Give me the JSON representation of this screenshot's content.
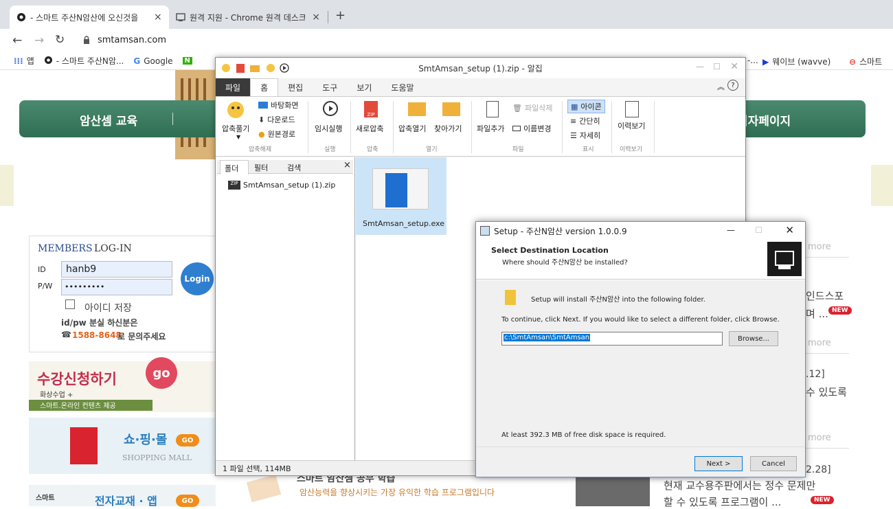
{
  "browser": {
    "tabs": [
      {
        "title": "- 스마트 주산N암산에 오신것을",
        "active": true
      },
      {
        "title": "원격 지원 - Chrome 원격 데스크",
        "active": false
      }
    ],
    "new_tab": "+",
    "url": "smtamsan.com",
    "bookmarks": [
      {
        "label": "앱",
        "icon": "apps-icon"
      },
      {
        "label": "- 스마트 주산N암...",
        "icon": "site-icon"
      },
      {
        "label": "Google",
        "icon": "google-icon"
      },
      {
        "label": "웨이브 (wavve)",
        "icon": "wavve-icon"
      },
      {
        "label": "스마트",
        "icon": "site-icon"
      }
    ],
    "bookmark_ellipsis": "-..."
  },
  "webpage": {
    "nav": {
      "left": "암산셈 교육",
      "right": "리자페이지"
    },
    "login": {
      "header_members": "MEMBERS",
      "header_login": "LOG-IN",
      "id_label": "ID",
      "pw_label": "P/W",
      "id_value": "hanb9",
      "pw_value": "•••••••••",
      "login_button": "Login",
      "remember": "아이디 저장",
      "lost_1": "id/pw 분실 하신분은",
      "phone": "1588-8648",
      "lost_2": "로 문의주세요"
    },
    "banners": {
      "apply": "수강신청하기",
      "apply_sub1": "화상수업 +",
      "apply_sub2": "스마트.온라인 컨텐츠 제공",
      "go": "go",
      "shop": "쇼·핑·몰",
      "shop_en": "SHOPPING MALL",
      "shop_go": "GO",
      "smart": "스마트",
      "ebook": "전자교재 · 앱",
      "ebook_go": "GO"
    },
    "center": {
      "heading": "스마트 암산셈 공부 학습",
      "sub": "암산능력을 향상시키는 가장 유익한 학습 프로그램입니다"
    },
    "right": {
      "more": "more",
      "text1": "인드스포",
      "text1b": "며 ...",
      "new": "NEW",
      "date1": ".12]",
      "text2": "수 있도록",
      "date2": "2.28]",
      "text3": "현재 교수용주판에서는 정수 문제만",
      "text4": "할 수 있도록 프로그램이 ..."
    }
  },
  "alzip": {
    "title": "SmtAmsan_setup (1).zip - 알집",
    "menus": [
      "파일",
      "홈",
      "편집",
      "도구",
      "보기",
      "도움말"
    ],
    "ribbon": {
      "extract": "압축풀기",
      "desktop": "바탕화면",
      "download": "다운로드",
      "original": "원본경로",
      "group_extract": "압축해제",
      "temp_run": "임시실행",
      "group_run": "실행",
      "new_zip": "새로압축",
      "group_zip": "압축",
      "open_zip": "압축열기",
      "find": "찾아가기",
      "group_open": "열기",
      "add_file": "파일추가",
      "delete_file": "파일삭제",
      "rename": "이름변경",
      "group_file": "파일",
      "icons": "아이콘",
      "simple": "간단히",
      "detail": "자세히",
      "group_view": "표시",
      "history": "이력보기",
      "group_history": "이력보기"
    },
    "panel_tabs": [
      "폴더",
      "필터",
      "검색"
    ],
    "tree_item": "SmtAmsan_setup (1).zip",
    "file_name": "SmtAmsan_setup.exe",
    "status": "1 파일 선택, 114MB"
  },
  "setup": {
    "title": "Setup - 주산N암산 version 1.0.0.9",
    "heading": "Select Destination Location",
    "subheading": "Where should 주산N암산 be installed?",
    "install_msg": "Setup will install 주산N암산 into the following folder.",
    "continue_msg": "To continue, click Next. If you would like to select a different folder, click Browse.",
    "path": "c:\\SmtAmsan\\SmtAmsan",
    "browse": "Browse...",
    "space": "At least 392.3 MB of free disk space is required.",
    "next": "Next >",
    "cancel": "Cancel"
  }
}
